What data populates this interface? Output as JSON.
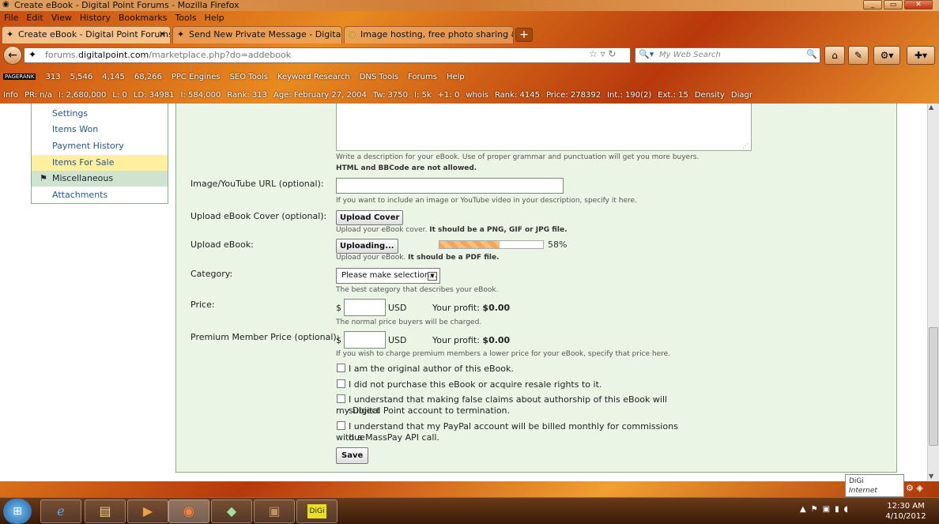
{
  "window": {
    "title": "Create eBook - Digital Point Forums - Mozilla Firefox"
  },
  "menu": [
    "File",
    "Edit",
    "View",
    "History",
    "Bookmarks",
    "Tools",
    "Help"
  ],
  "tabs": [
    {
      "label": "Create eBook - Digital Point Forums"
    },
    {
      "label": "Send New Private Message - Digital P..."
    },
    {
      "label": "Image hosting, free photo sharing & ..."
    }
  ],
  "nav": {
    "url_prefix": "forums.",
    "url_domain": "digitalpoint.com",
    "url_path": "/marketplace.php?do=addebook",
    "search_placeholder": "My Web Search"
  },
  "toolbar1": {
    "pagerank": "PAGERANK",
    "items": [
      "313",
      "5,546",
      "4,145",
      "68,266",
      "PPC Engines",
      "SEO Tools",
      "Keyword Research",
      "DNS Tools",
      "Forums",
      "Help"
    ]
  },
  "toolbar2": {
    "items": [
      "Info",
      "PR: n/a",
      "I: 2,680,000",
      "L: 0",
      "LD: 34981",
      "I: 584,000",
      "Rank: 313",
      "Age: February 27, 2004",
      "Tw: 3750",
      "I: 5k",
      "+1: 0",
      "whois",
      "Rank: 4145",
      "Price: 278392",
      "Int.: 190(2)",
      "Ext.: 15",
      "Density",
      "Diagr"
    ]
  },
  "sidebar": {
    "items": [
      {
        "label": "Settings"
      },
      {
        "label": "Items Won"
      },
      {
        "label": "Payment History"
      },
      {
        "label": "Items For Sale"
      },
      {
        "label": "Miscellaneous"
      },
      {
        "label": "Attachments"
      }
    ]
  },
  "form": {
    "desc_note": "Write a description for your eBook. Use of proper grammar and punctuation will get you more buyers.",
    "desc_note_bold": "HTML and BBCode are not allowed.",
    "image_label": "Image/YouTube URL (optional):",
    "image_note": "If you want to include an image or YouTube video in your description, specify it here.",
    "cover_label": "Upload eBook Cover (optional):",
    "cover_button": "Upload Cover",
    "cover_note": "Upload your eBook cover.",
    "cover_note_bold": "It should be a PNG, GIF or JPG file.",
    "ebook_label": "Upload eBook:",
    "ebook_button": "Uploading...",
    "progress_percent": 58,
    "progress_text": "58%",
    "ebook_note": "Upload your eBook.",
    "ebook_note_bold": "It should be a PDF file.",
    "category_label": "Category:",
    "category_value": "Please make selection...",
    "category_note": "The best category that describes your eBook.",
    "price_label": "Price:",
    "currency_symbol": "$",
    "currency_code": "USD",
    "profit_label": "Your profit:",
    "profit_value": "$0.00",
    "price_note": "The normal price buyers will be charged.",
    "premium_label": "Premium Member Price (optional):",
    "premium_profit_value": "$0.00",
    "premium_note": "If you wish to charge premium members a lower price for your eBook, specify that price here.",
    "check1": "I am the original author of this eBook.",
    "check2": "I did not purchase this eBook or acquire resale rights to it.",
    "check3a": "I understand that making false claims about authorship of this eBook will subject",
    "check3b": "my Digital Point account to termination.",
    "check4a": "I understand that my PayPal account will be billed monthly for commissions due",
    "check4b": "with a MassPay API call.",
    "save_button": "Save"
  },
  "tooltip": {
    "title": "DiGi",
    "subtitle": "Internet access"
  },
  "taskbar": {
    "time": "12:30 AM",
    "date": "4/10/2012",
    "digi_label": "DiGi"
  }
}
